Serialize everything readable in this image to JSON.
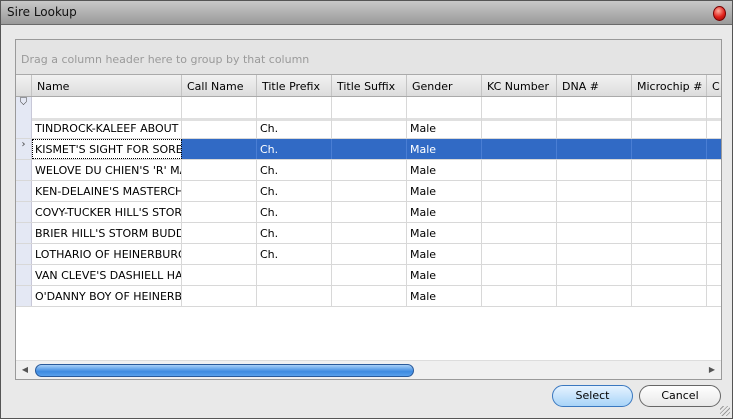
{
  "window": {
    "title": "Sire Lookup"
  },
  "grid": {
    "group_hint": "Drag a column header here to group by that column",
    "columns": [
      "Name",
      "Call Name",
      "Title Prefix",
      "Title Suffix",
      "Gender",
      "KC Number",
      "DNA #",
      "Microchip #",
      "C"
    ],
    "selected_row": 1,
    "rows": [
      [
        "TINDROCK-KALEEF ABOUT ...",
        "",
        "Ch.",
        "",
        "Male",
        "",
        "",
        "",
        ""
      ],
      [
        "KISMET'S SIGHT FOR SORE...",
        "",
        "Ch.",
        "",
        "Male",
        "",
        "",
        "",
        ""
      ],
      [
        "WELOVE DU CHIEN'S 'R' MAN",
        "",
        "Ch.",
        "",
        "Male",
        "",
        "",
        "",
        ""
      ],
      [
        "KEN-DELAINE'S MASTERCH...",
        "",
        "Ch.",
        "",
        "Male",
        "",
        "",
        "",
        ""
      ],
      [
        "COVY-TUCKER HILL'S STOR...",
        "",
        "Ch.",
        "",
        "Male",
        "",
        "",
        "",
        ""
      ],
      [
        "BRIER HILL'S STORM BUDDY",
        "",
        "Ch.",
        "",
        "Male",
        "",
        "",
        "",
        ""
      ],
      [
        "LOTHARIO OF HEINERBURG",
        "",
        "Ch.",
        "",
        "Male",
        "",
        "",
        "",
        ""
      ],
      [
        "VAN CLEVE'S DASHIELL HA...",
        "",
        "",
        "",
        "Male",
        "",
        "",
        "",
        ""
      ],
      [
        "O'DANNY BOY OF HEINERB...",
        "",
        "",
        "",
        "Male",
        "",
        "",
        "",
        ""
      ]
    ]
  },
  "buttons": {
    "select": "Select",
    "cancel": "Cancel"
  },
  "colors": {
    "selection": "#316ac5"
  }
}
